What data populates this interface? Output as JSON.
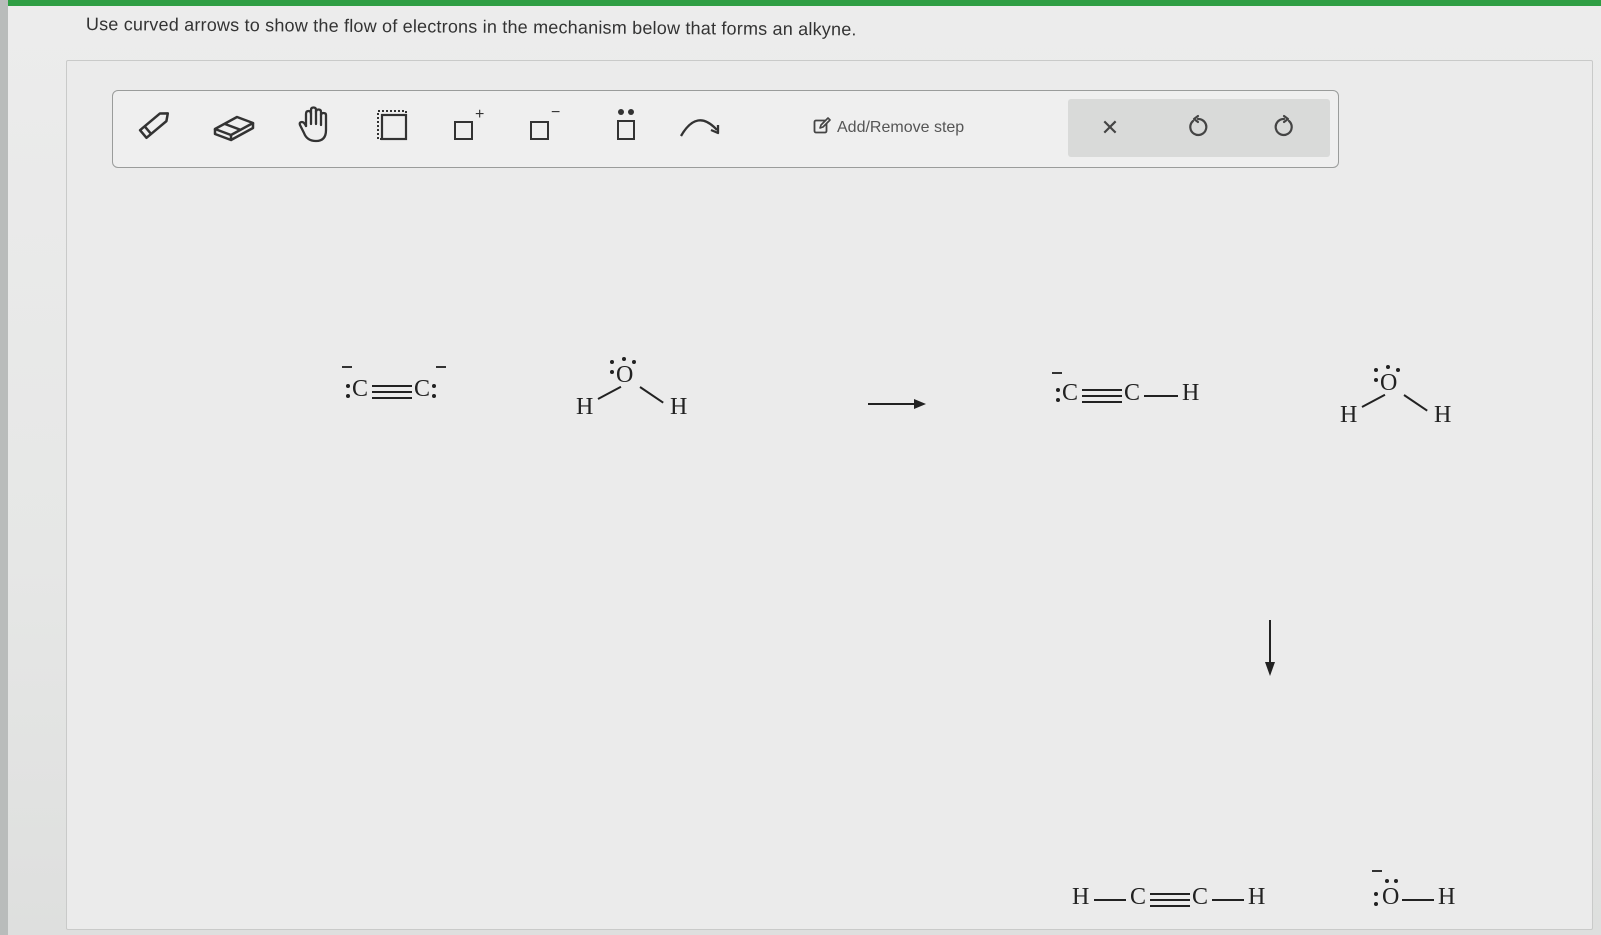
{
  "prompt": "Use curved arrows to show the flow of electrons in the mechanism below that forms an alkyne.",
  "toolbar": {
    "tools": [
      {
        "name": "pencil-icon"
      },
      {
        "name": "eraser-icon"
      },
      {
        "name": "hand-icon"
      },
      {
        "name": "select-box-icon"
      },
      {
        "name": "positive-charge-icon",
        "sup": "+"
      },
      {
        "name": "negative-charge-icon",
        "sup": "−"
      },
      {
        "name": "lone-pair-icon"
      },
      {
        "name": "curved-arrow-icon"
      }
    ],
    "step_label": "Add/Remove step",
    "actions": [
      {
        "name": "clear-icon",
        "glyph": "✕"
      },
      {
        "name": "undo-icon"
      },
      {
        "name": "redo-icon"
      }
    ]
  },
  "reactants": {
    "acetylide": {
      "left": "C",
      "right": "C"
    },
    "water": {
      "o": "O",
      "h_left": "H",
      "h_right": "H"
    }
  },
  "intermediate": {
    "acetylide": {
      "c1": "C",
      "c2": "C",
      "h": "H"
    },
    "water": {
      "o": "O",
      "h_left": "H",
      "h_right": "H"
    }
  },
  "products": {
    "alkyne": {
      "h1": "H",
      "c1": "C",
      "c2": "C",
      "h2": "H"
    },
    "hydroxide": {
      "o": "O",
      "h": "H"
    }
  }
}
